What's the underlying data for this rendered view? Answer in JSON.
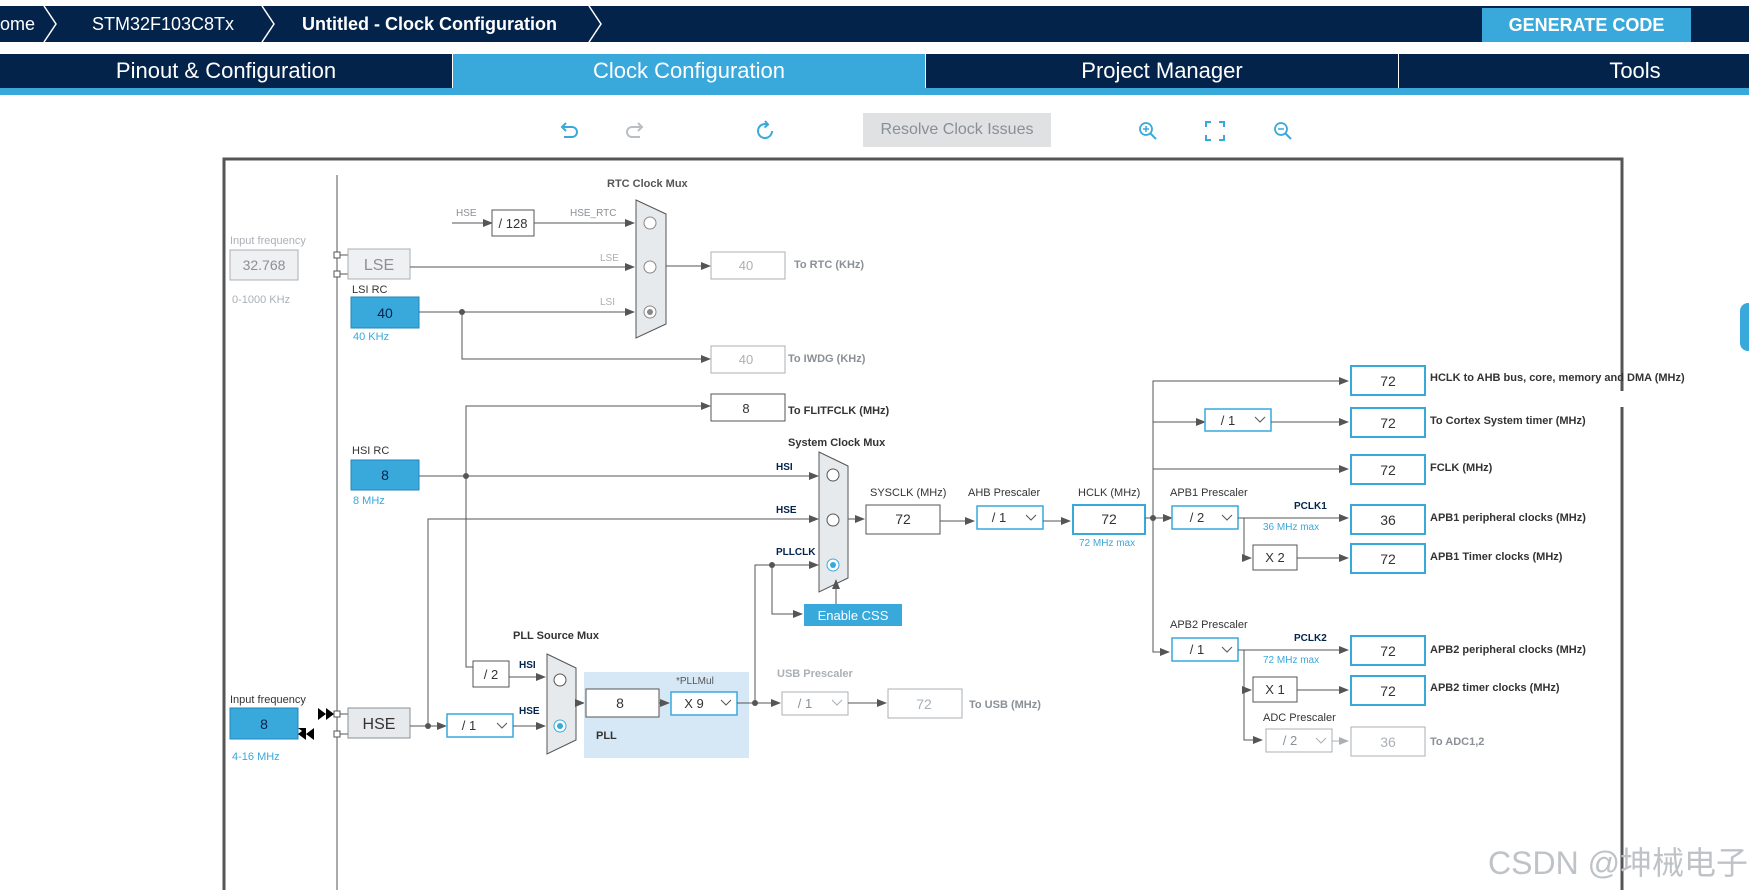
{
  "breadcrumbs": [
    "ome",
    "STM32F103C8Tx",
    "Untitled - Clock Configuration"
  ],
  "generate_code_label": "GENERATE CODE",
  "tabs": [
    "Pinout & Configuration",
    "Clock Configuration",
    "Project Manager",
    "Tools"
  ],
  "active_tab": "Clock Configuration",
  "toolbar": {
    "icons": [
      "undo-icon",
      "redo-icon",
      "refresh-icon",
      "zoom-in-icon",
      "fit-screen-icon",
      "zoom-out-icon"
    ],
    "resolve_label": "Resolve Clock Issues"
  },
  "diagram": {
    "rtc_mux_title": "RTC Clock Mux",
    "lse_input_freq_label": "Input frequency",
    "lse_input_freq": "32.768",
    "lse_range": "0-1000 KHz",
    "lse_label": "LSE",
    "lsi_rc_label": "LSI RC",
    "lsi_value": "40",
    "lsi_freq": "40 KHz",
    "hse_label_small": "HSE",
    "div128": "/ 128",
    "hse_rtc": "HSE_RTC",
    "lse_line": "LSE",
    "lsi_line": "LSI",
    "rtc_out": "40",
    "to_rtc": "To RTC (KHz)",
    "iwdg_out": "40",
    "to_iwdg": "To IWDG (KHz)",
    "flit_out": "8",
    "to_flit": "To FLITFCLK (MHz)",
    "hsi_rc_label": "HSI RC",
    "hsi_value": "8",
    "hsi_freq": "8 MHz",
    "sys_mux_title": "System Clock Mux",
    "mux_hsi": "HSI",
    "mux_hse": "HSE",
    "mux_pllclk": "PLLCLK",
    "enable_css": "Enable CSS",
    "sysclk_label": "SYSCLK (MHz)",
    "sysclk": "72",
    "ahb_label": "AHB Prescaler",
    "ahb": "/ 1",
    "hclk_label": "HCLK (MHz)",
    "hclk": "72",
    "hclk_max": "72 MHz max",
    "apb1_label": "APB1 Prescaler",
    "apb1": "/ 2",
    "pclk1": "PCLK1",
    "pclk1_max": "36 MHz max",
    "x2": "X 2",
    "apb2_label": "APB2 Prescaler",
    "apb2": "/ 1",
    "pclk2": "PCLK2",
    "pclk2_max": "72 MHz max",
    "x1": "X 1",
    "adc_label": "ADC Prescaler",
    "adc": "/ 2",
    "cortex_div": "/ 1",
    "outputs": [
      {
        "value": "72",
        "label": "HCLK to AHB bus, core, memory and DMA (MHz)"
      },
      {
        "value": "72",
        "label": "To Cortex System timer (MHz)"
      },
      {
        "value": "72",
        "label": "FCLK (MHz)"
      },
      {
        "value": "36",
        "label": "APB1 peripheral clocks (MHz)"
      },
      {
        "value": "72",
        "label": "APB1 Timer clocks (MHz)"
      },
      {
        "value": "72",
        "label": "APB2 peripheral clocks (MHz)"
      },
      {
        "value": "72",
        "label": "APB2 timer clocks (MHz)"
      },
      {
        "value": "36",
        "label": "To ADC1,2"
      }
    ],
    "pll_src_title": "PLL Source Mux",
    "pll_hsi": "HSI",
    "pll_hse": "HSE",
    "div2": "/ 2",
    "hse_input_freq_label": "Input frequency",
    "hse_value": "8",
    "hse_range": "4-16 MHz",
    "hse_label": "HSE",
    "hse_div": "/ 1",
    "pll_in": "8",
    "pllmul_label": "*PLLMul",
    "pllmul": "X 9",
    "pll_label": "PLL",
    "usb_label": "USB Prescaler",
    "usb": "/ 1",
    "usb_out": "72",
    "to_usb": "To USB (MHz)"
  },
  "watermark": "CSDN @坤械电子",
  "colors": {
    "nav": "#03234b",
    "accent": "#39a9dc",
    "line": "#555555",
    "muted": "#aab0b6"
  }
}
